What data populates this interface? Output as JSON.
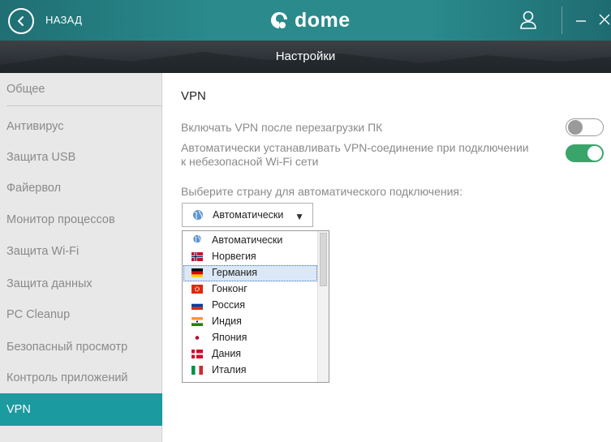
{
  "titlebar": {
    "back_label": "НАЗАД",
    "logo_text": "dome",
    "accent_color": "#2a8a8c"
  },
  "subheader": {
    "title": "Настройки"
  },
  "sidebar": {
    "items": [
      {
        "label": "Общее"
      },
      {
        "label": "Антивирус"
      },
      {
        "label": "Защита USB"
      },
      {
        "label": "Файервол"
      },
      {
        "label": "Монитор процессов"
      },
      {
        "label": "Защита Wi-Fi"
      },
      {
        "label": "Защита данных"
      },
      {
        "label": "PC Cleanup"
      },
      {
        "label": "Безопасный просмотр"
      },
      {
        "label": "Контроль приложений"
      },
      {
        "label": "VPN",
        "active": true
      }
    ]
  },
  "main": {
    "section_title": "VPN",
    "option_restart": {
      "label": "Включать VPN после перезагрузки ПК",
      "enabled": false
    },
    "option_auto": {
      "label_line1": "Автоматически устанавливать VPN-соединение при подключении",
      "label_line2": "к небезопасной Wi-Fi сети",
      "enabled": true
    },
    "country_prompt": "Выберите страну для автоматического подключения:",
    "country_select": {
      "value": "Автоматически",
      "icon": "globe-icon"
    },
    "country_options": [
      {
        "label": "Автоматически",
        "icon": "globe-icon"
      },
      {
        "label": "Норвегия",
        "icon": "flag-norway-icon"
      },
      {
        "label": "Германия",
        "icon": "flag-germany-icon",
        "selected": true
      },
      {
        "label": "Гонконг",
        "icon": "flag-hongkong-icon"
      },
      {
        "label": "Россия",
        "icon": "flag-russia-icon"
      },
      {
        "label": "Индия",
        "icon": "flag-india-icon"
      },
      {
        "label": "Япония",
        "icon": "flag-japan-icon"
      },
      {
        "label": "Дания",
        "icon": "flag-denmark-icon"
      },
      {
        "label": "Италия",
        "icon": "flag-italy-icon"
      }
    ]
  },
  "colors": {
    "sidebar_active": "#1b9aa0",
    "toggle_on": "#3aa56b",
    "selection": "#dbe8f7"
  }
}
